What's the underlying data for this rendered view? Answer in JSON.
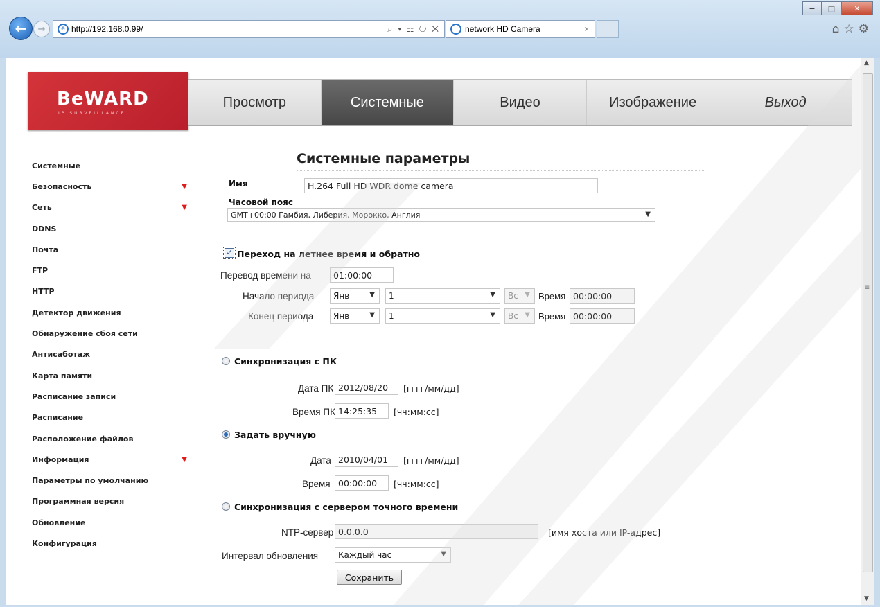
{
  "browser": {
    "url": "http://192.168.0.99/",
    "tab_title": "network HD Camera",
    "addr_tools": "⌕ ▾ ☷ ↻ ✕",
    "toolbar_icons": "⌂☆⚙",
    "win_min": "−",
    "win_max": "□",
    "win_close": "✕"
  },
  "logo": {
    "name": "BeWARD",
    "tagline": "IP SURVEILLANCE"
  },
  "menu": {
    "items": [
      {
        "label": "Просмотр"
      },
      {
        "label": "Системные"
      },
      {
        "label": "Видео"
      },
      {
        "label": "Изображение"
      },
      {
        "label": "Выход"
      }
    ],
    "active": "Системные"
  },
  "sidebar": {
    "items": [
      {
        "label": "Системные",
        "has_arrow": false
      },
      {
        "label": "Безопасность",
        "has_arrow": true
      },
      {
        "label": "Сеть",
        "has_arrow": true
      },
      {
        "label": "DDNS",
        "has_arrow": false
      },
      {
        "label": "Почта",
        "has_arrow": false
      },
      {
        "label": "FTP",
        "has_arrow": false
      },
      {
        "label": "HTTP",
        "has_arrow": false
      },
      {
        "label": "Детектор движения",
        "has_arrow": false
      },
      {
        "label": "Обнаружение сбоя сети",
        "has_arrow": false
      },
      {
        "label": "Антисаботаж",
        "has_arrow": false
      },
      {
        "label": "Карта памяти",
        "has_arrow": false
      },
      {
        "label": "Расписание записи",
        "has_arrow": false
      },
      {
        "label": "Расписание",
        "has_arrow": false
      },
      {
        "label": "Расположение файлов",
        "has_arrow": false
      },
      {
        "label": "Информация",
        "has_arrow": true
      },
      {
        "label": "Параметры по умолчанию",
        "has_arrow": false
      },
      {
        "label": "Программная версия",
        "has_arrow": false
      },
      {
        "label": "Обновление",
        "has_arrow": false
      },
      {
        "label": "Конфигурация",
        "has_arrow": false
      }
    ]
  },
  "form": {
    "title": "Системные параметры",
    "name_label": "Имя",
    "name_value": "H.264 Full HD WDR dome camera",
    "tz_label": "Часовой пояс",
    "tz_value": "GMT+00:00 Гамбия, Либерия, Морокко, Англия",
    "dst_label": "Переход на летнее время и обратно",
    "dst_checked": true,
    "shift_label": "Перевод времени на",
    "shift_value": "01:00:00",
    "start_label": "Начало периода",
    "end_label": "Конец периода",
    "month_value": "Янв",
    "week_value": "1",
    "day_value": "Вс",
    "time_label": "Время",
    "start_time": "00:00:00",
    "end_time": "00:00:00",
    "sync_pc_label": "Синхронизация с ПК",
    "pc_date_label": "Дата ПК",
    "pc_date_value": "2012/08/20",
    "date_format": "[гггг/мм/дд]",
    "pc_time_label": "Время ПК",
    "pc_time_value": "14:25:35",
    "time_format": "[чч:мм:сс]",
    "manual_label": "Задать вручную",
    "date_label": "Дата",
    "date_value": "2010/04/01",
    "manual_time_label": "Время",
    "manual_time_value": "00:00:00",
    "ntp_sync_label": "Синхронизация с сервером точного времени",
    "ntp_label": "NTP-сервер",
    "ntp_value": "0.0.0.0",
    "ntp_hint": "[имя хоста или IP-адрес]",
    "interval_label": "Интервал обновления",
    "interval_value": "Каждый час",
    "save_label": "Сохранить",
    "selected_sync": "manual"
  },
  "colors": {
    "brand_red": "#c8282f",
    "menu_active": "#555555",
    "accent_blue": "#2e6ab7"
  }
}
